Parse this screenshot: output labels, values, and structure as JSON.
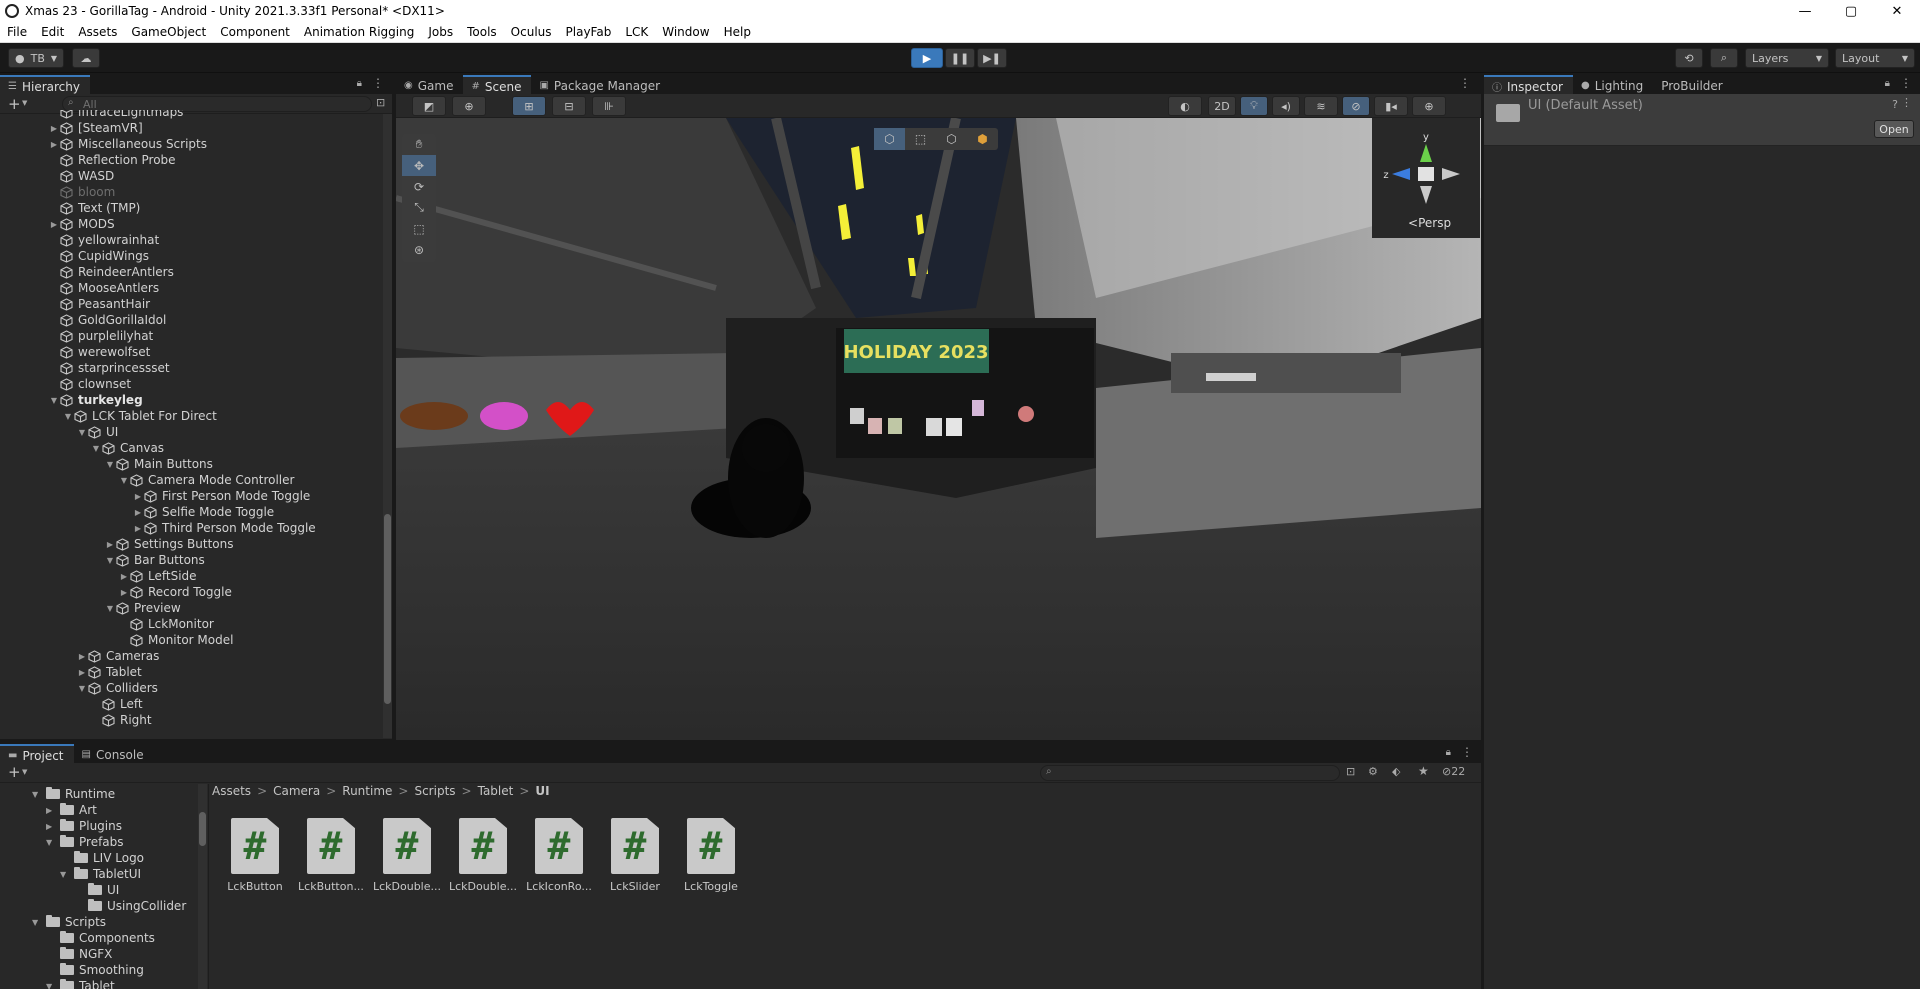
{
  "window": {
    "title": "Xmas 23 - GorillaTag - Android - Unity 2021.3.33f1 Personal* <DX11>",
    "minimize": "—",
    "maximize": "▢",
    "close": "✕"
  },
  "menu": [
    "File",
    "Edit",
    "Assets",
    "GameObject",
    "Component",
    "Animation Rigging",
    "Jobs",
    "Tools",
    "Oculus",
    "PlayFab",
    "LCK",
    "Window",
    "Help"
  ],
  "toolbar": {
    "account": "TB",
    "layers": "Layers",
    "layout": "Layout"
  },
  "hierarchy": {
    "tab": "Hierarchy",
    "search_placeholder": "All",
    "add": "+",
    "items": [
      {
        "label": "lfftraceLightmaps"
      },
      {
        "label": "[SteamVR]"
      },
      {
        "label": "Miscellaneous Scripts"
      },
      {
        "label": "Reflection Probe"
      },
      {
        "label": "WASD"
      },
      {
        "label": "bloom"
      },
      {
        "label": "Text (TMP)"
      },
      {
        "label": "MODS"
      },
      {
        "label": "yellowrainhat"
      },
      {
        "label": "CupidWings"
      },
      {
        "label": "ReindeerAntlers"
      },
      {
        "label": "MooseAntlers"
      },
      {
        "label": "PeasantHair"
      },
      {
        "label": "GoldGorillaIdol"
      },
      {
        "label": "purplelilyhat"
      },
      {
        "label": "werewolfset"
      },
      {
        "label": "starprincessset"
      },
      {
        "label": "clownset"
      },
      {
        "label": "turkeyleg"
      },
      {
        "label": "LCK Tablet For Direct"
      },
      {
        "label": "UI"
      },
      {
        "label": "Canvas"
      },
      {
        "label": "Main Buttons"
      },
      {
        "label": "Camera Mode Controller"
      },
      {
        "label": "First Person Mode Toggle"
      },
      {
        "label": "Selfie Mode Toggle"
      },
      {
        "label": "Third Person Mode Toggle"
      },
      {
        "label": "Settings Buttons"
      },
      {
        "label": "Bar Buttons"
      },
      {
        "label": "LeftSide"
      },
      {
        "label": "Record Toggle"
      },
      {
        "label": "Preview"
      },
      {
        "label": "LckMonitor"
      },
      {
        "label": "Monitor Model"
      },
      {
        "label": "Cameras"
      },
      {
        "label": "Tablet"
      },
      {
        "label": "Colliders"
      },
      {
        "label": "Left"
      },
      {
        "label": "Right"
      }
    ]
  },
  "scene_tabs": {
    "game": "Game",
    "scene": "Scene",
    "package_manager": "Package Manager",
    "mode_2d": "2D",
    "persp": "Persp",
    "axis_y": "y",
    "axis_z": "z",
    "banner": "HOLIDAY 2023"
  },
  "inspector": {
    "tab": "Inspector",
    "lighting": "Lighting",
    "probuilder": "ProBuilder",
    "asset_name": "UI (Default Asset)",
    "open_button": "Open"
  },
  "project": {
    "tab_project": "Project",
    "tab_console": "Console",
    "hidden_count": "22",
    "breadcrumb": [
      "Assets",
      "Camera",
      "Runtime",
      "Scripts",
      "Tablet",
      "UI"
    ],
    "tree": [
      {
        "label": "Runtime"
      },
      {
        "label": "Art"
      },
      {
        "label": "Plugins"
      },
      {
        "label": "Prefabs"
      },
      {
        "label": "LIV Logo"
      },
      {
        "label": "TabletUI"
      },
      {
        "label": "UI"
      },
      {
        "label": "UsingCollider"
      },
      {
        "label": "Scripts"
      },
      {
        "label": "Components"
      },
      {
        "label": "NGFX"
      },
      {
        "label": "Smoothing"
      },
      {
        "label": "Tablet"
      }
    ],
    "assets": [
      {
        "label": "LckButton",
        "glyph": "#"
      },
      {
        "label": "LckButton...",
        "glyph": "#"
      },
      {
        "label": "LckDouble...",
        "glyph": "#"
      },
      {
        "label": "LckDouble...",
        "glyph": "#"
      },
      {
        "label": "LckIconRo...",
        "glyph": "#"
      },
      {
        "label": "LckSlider",
        "glyph": "#"
      },
      {
        "label": "LckToggle",
        "glyph": "#"
      }
    ]
  },
  "colors": {
    "accent": "#3a79bb",
    "panel": "#282828",
    "titlebar": "#ffffff",
    "script_hash": "#2e6b2e"
  }
}
